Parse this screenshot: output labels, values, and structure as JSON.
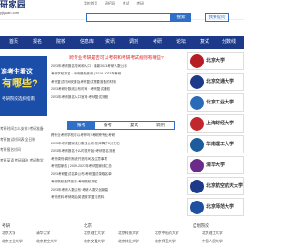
{
  "header": {
    "logo_text": "研家园",
    "logo_sub": "yjiyuan.com",
    "top_links": [
      "我的首页",
      "研招网",
      "考试",
      "考研"
    ],
    "search_placeholder": "",
    "search_button": "搜索",
    "register_button": "我要提问"
  },
  "nav": {
    "items": [
      "首页",
      "报名",
      "院校",
      "信息库",
      "资讯",
      "调剂",
      "考研",
      "论坛",
      "复试",
      "分数线"
    ]
  },
  "banner": {
    "line1": "准考生看这",
    "line2": "有哪些?",
    "line3": "考研院校选择指南"
  },
  "left_list": [
    "考研时间怎么安排?考研准备",
    "考研复试时间表 全日制",
    "考研报名时间",
    "考研英语 考研政治 考研数学"
  ],
  "news": {
    "headline": "跨专业考研是否可以考研和考研考试规则有哪些?",
    "items": [
      "2023年考研报名时间和入口 · 最新2023考研人数公布",
      "考研学校排名 · 考研最新资讯 | 2019-2023年考研",
      "考研复试时间安排及考研复试需要准备的材料",
      "2023考研分数线公布时间 · 考研复试通知",
      "2023年考研报名入口官网·考研复试流程"
    ]
  },
  "tabs": [
    "报考",
    "备考",
    "复试",
    "调剂"
  ],
  "news2": {
    "items": [
      "跨专业考研学校可以考研吗?考研跨专业考研",
      "2023年考研国家线分数线公布,总体降了5分左右",
      "2023年考研报名什么时候开始?考研报名流程",
      "考研调剂:调剂系统开放时间及注意事项",
      "考研国家线 | 2019-2023年考研国家线汇总",
      "2023考研复试名单公布·考研复试录取名单",
      "考研院校选择技巧·考研院校排名",
      "2023年考研人数公布·考研人数又创新高",
      "考研资料:考研政治英语数学复习资料"
    ]
  },
  "schools": [
    {
      "name": "北京大学",
      "color": "#b51f24"
    },
    {
      "name": "北京交通大学",
      "color": "#1d3a8a"
    },
    {
      "name": "北京工业大学",
      "color": "#2a6bb8"
    },
    {
      "name": "上海财经大学",
      "color": "#c0282d"
    },
    {
      "name": "华南理工大学",
      "color": "#1d5c9c"
    },
    {
      "name": "清华大学",
      "color": "#6b2b8a"
    },
    {
      "name": "北京航空航天大学",
      "color": "#1d3a8a"
    },
    {
      "name": "北京师范大学",
      "color": "#1f4fa0"
    },
    {
      "name": "北京理工大学",
      "color": "#2c6e3a"
    }
  ],
  "bottom": {
    "heading_left": "考研",
    "heading_mid": "北京",
    "heading_right": "自划院校",
    "row1": [
      "北京大学",
      "清华大学",
      "北京理工大学",
      "北京科技大学",
      "北京中医药大学",
      "北京理工大学"
    ],
    "row2": [
      "北京工业大学",
      "北京航空大学",
      "北京交通大学",
      "北京林业大学",
      "北京师范大学",
      "中国人民大学"
    ]
  }
}
